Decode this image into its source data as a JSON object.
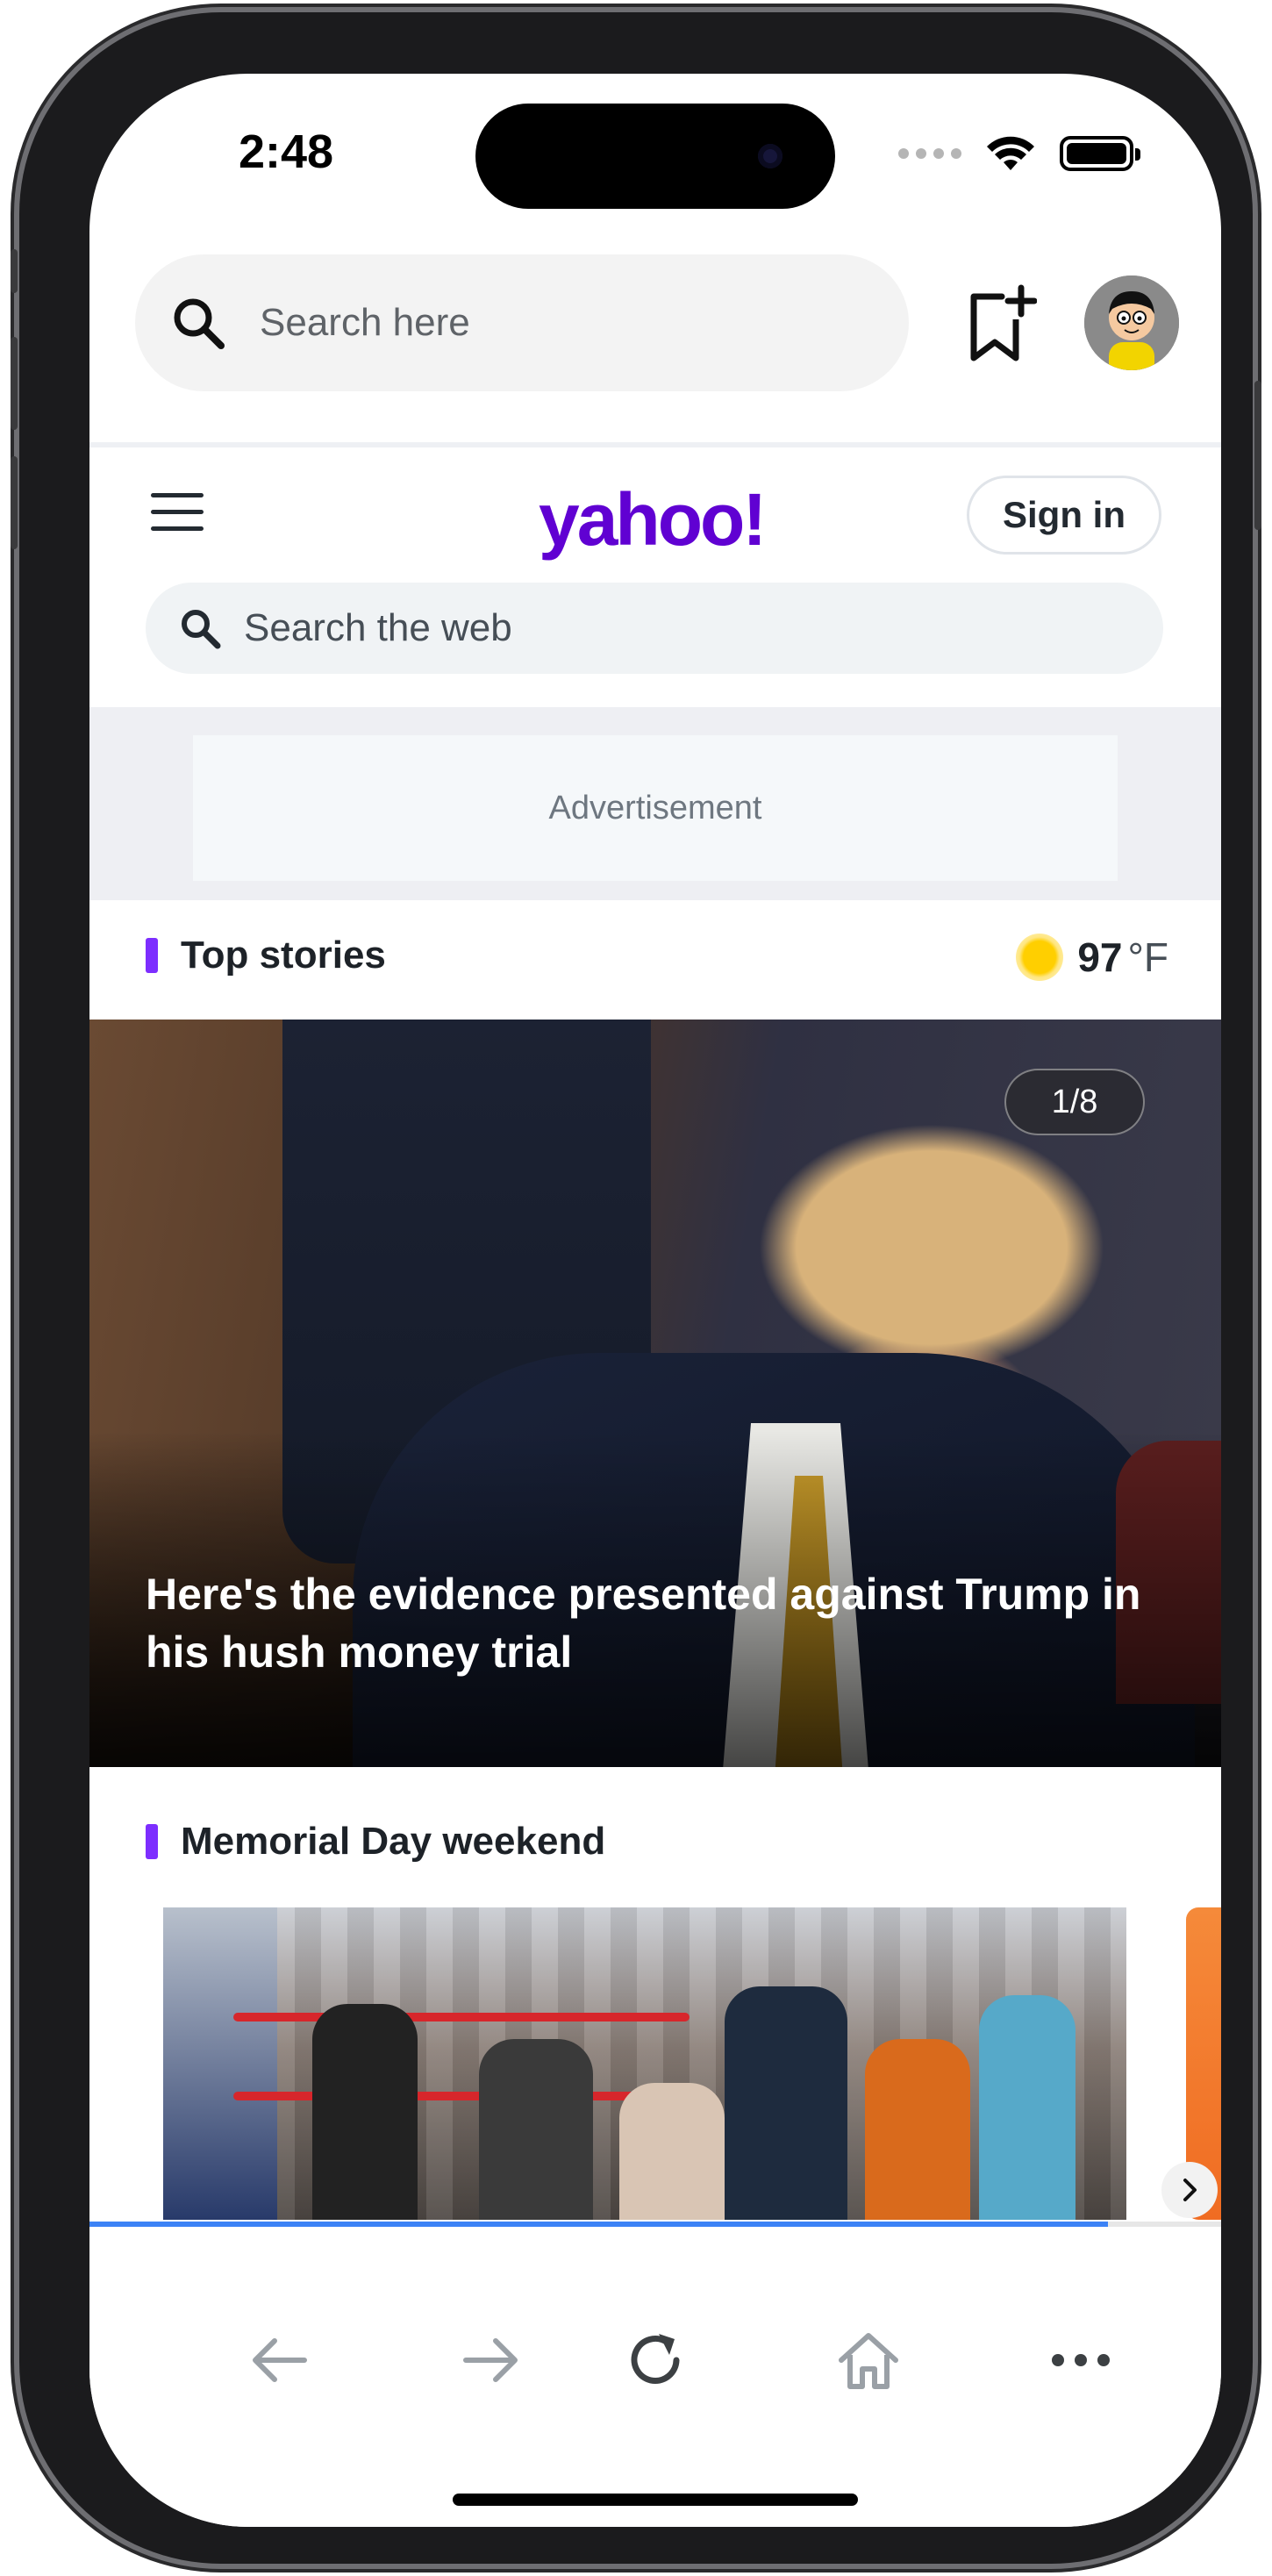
{
  "status_bar": {
    "time": "2:48"
  },
  "browser": {
    "search_placeholder": "Search here",
    "icons": [
      "search-icon",
      "bookmark-add-icon",
      "avatar"
    ]
  },
  "yahoo": {
    "logo_text": "yahoo!",
    "sign_in_label": "Sign in",
    "web_search_placeholder": "Search the web",
    "ad_label": "Advertisement"
  },
  "top_stories": {
    "title": "Top stories",
    "weather_temp": "97",
    "weather_unit": "°F",
    "hero": {
      "counter": "1/8",
      "headline": "Here's the evidence presented against Trump in his hush money trial"
    }
  },
  "memorial": {
    "title": "Memorial Day weekend"
  },
  "carousel_progress": 0.9,
  "colors": {
    "brand": "#6001d2",
    "section_accent": "#7d2eff",
    "progress": "#3b82f6"
  },
  "toolbar": {
    "items": [
      "back-icon",
      "forward-icon",
      "reload-icon",
      "home-icon",
      "more-icon"
    ]
  }
}
